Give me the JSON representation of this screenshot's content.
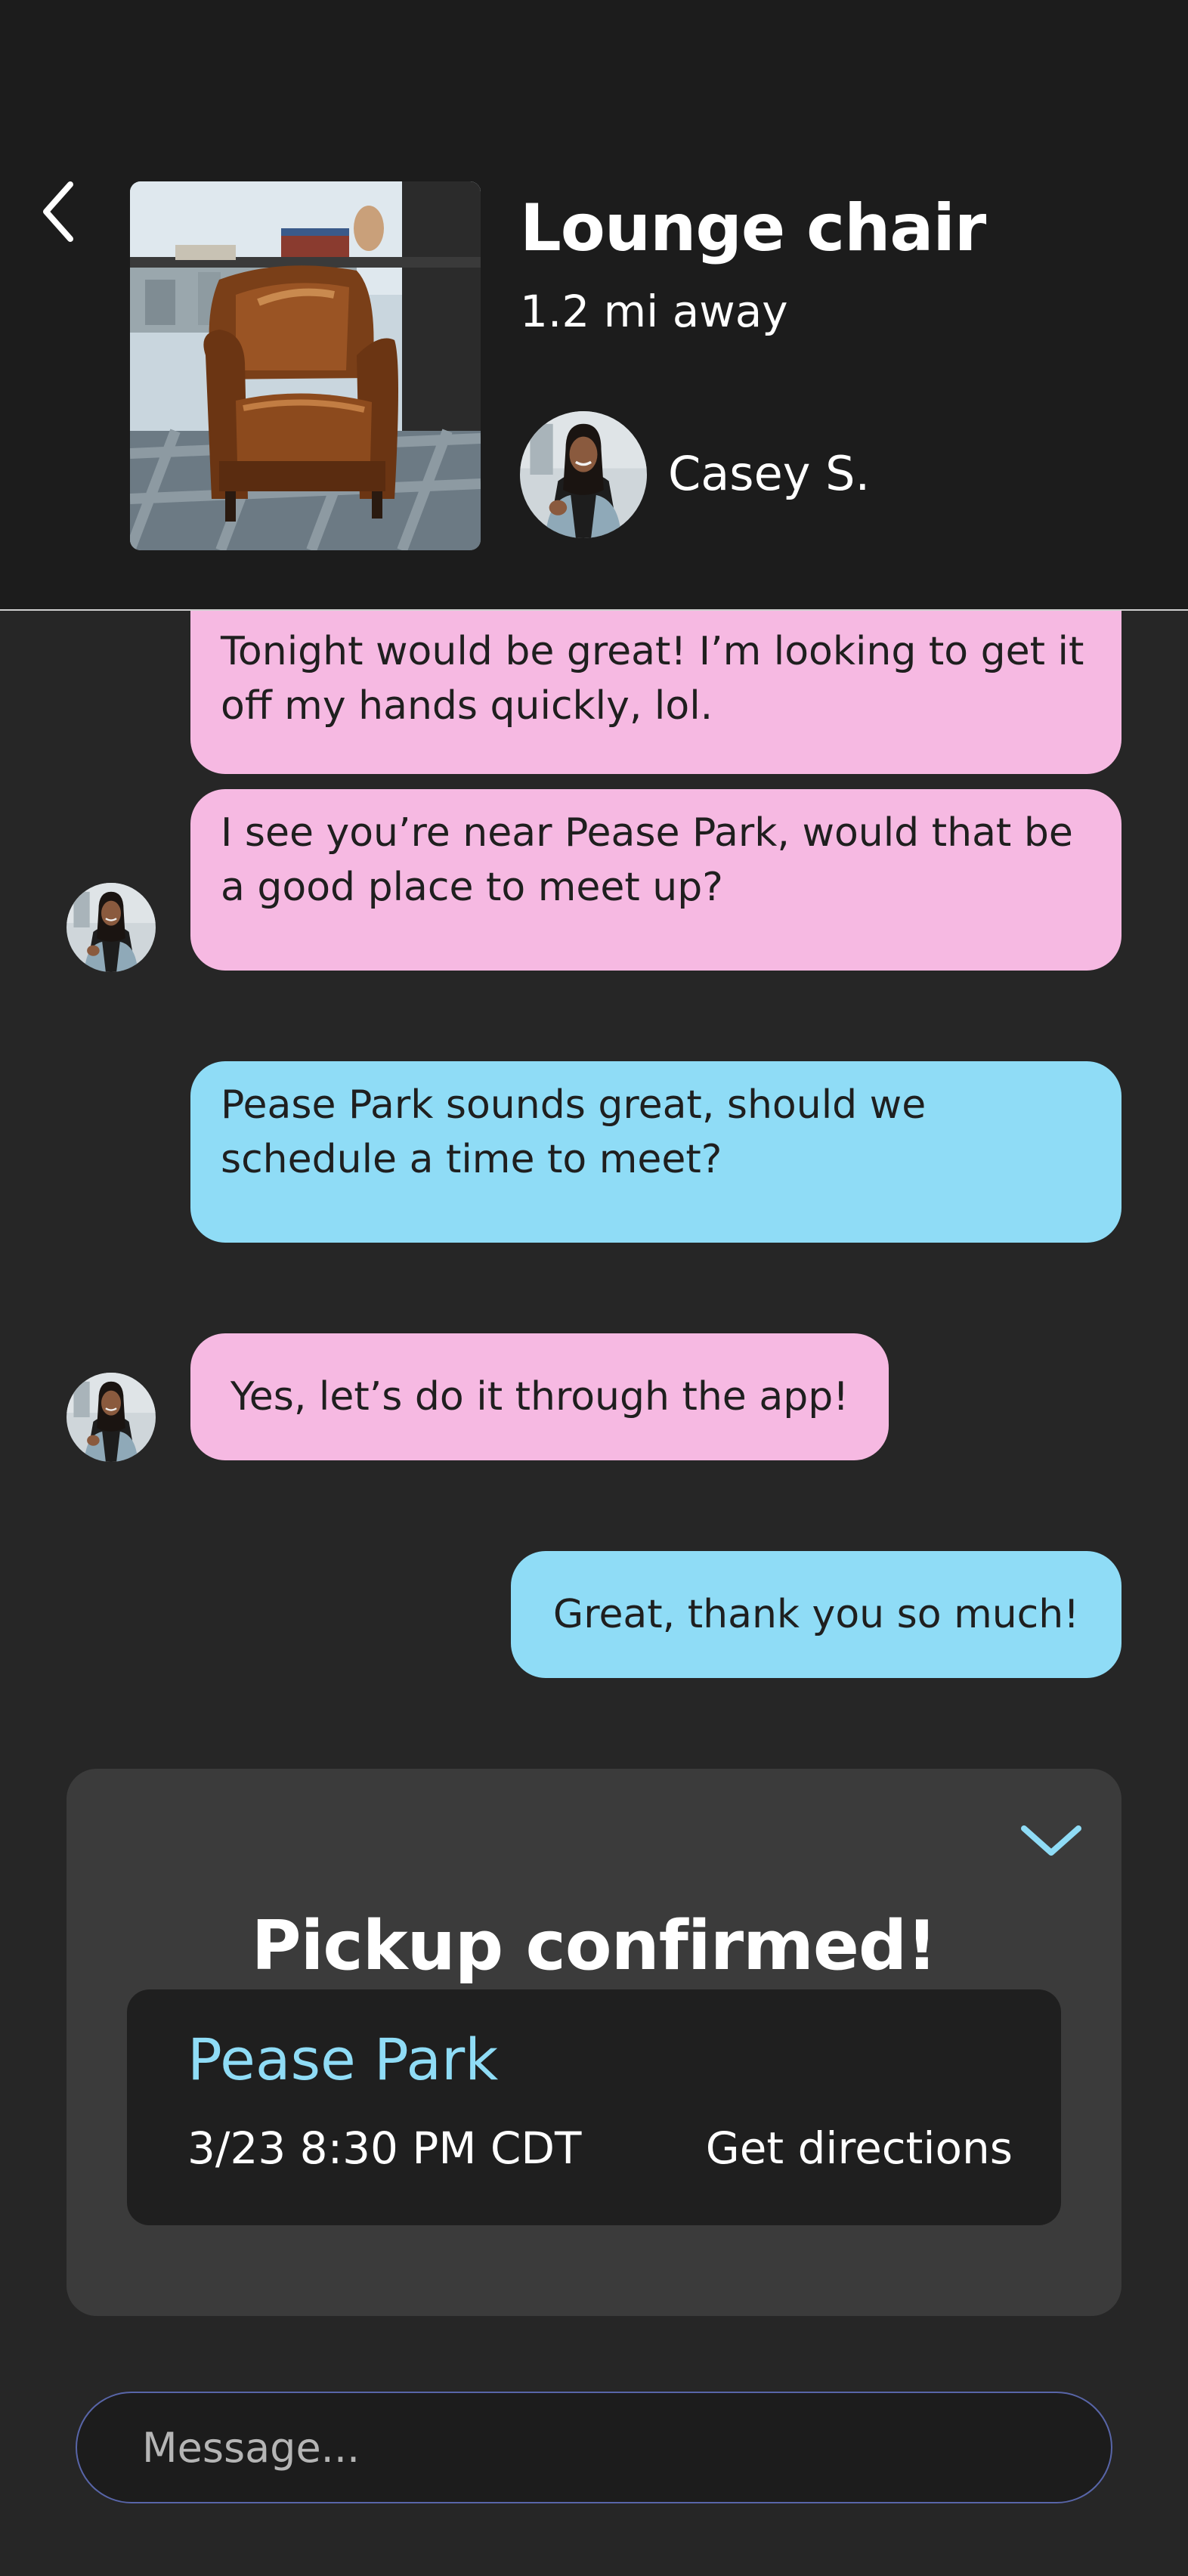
{
  "listing": {
    "title": "Lounge chair",
    "distance": "1.2 mi away",
    "seller_name": "Casey S."
  },
  "messages": [
    {
      "sender": "them",
      "text": "Tonight would be great! I’m looking to get it off my hands quickly, lol."
    },
    {
      "sender": "them",
      "text": "I see you’re near Pease Park, would that be a good place to meet up?"
    },
    {
      "sender": "me",
      "text": "Pease Park sounds great, should we schedule a time to meet?"
    },
    {
      "sender": "them",
      "text": "Yes, let’s do it through the app!"
    },
    {
      "sender": "me",
      "text": "Great, thank you so much!"
    }
  ],
  "pickup": {
    "heading": "Pickup confirmed!",
    "location": "Pease Park",
    "datetime": "3/23 8:30 PM CDT",
    "directions_label": "Get directions"
  },
  "composer": {
    "placeholder": "Message..."
  },
  "icons": {
    "back": "chevron-left-icon",
    "collapse": "chevron-down-icon"
  },
  "colors": {
    "background": "#262626",
    "header": "#1c1c1c",
    "their_bubble": "#f6b9e2",
    "my_bubble": "#8fdcf6",
    "accent": "#8fdcf6",
    "card": "#3b3b3b"
  }
}
